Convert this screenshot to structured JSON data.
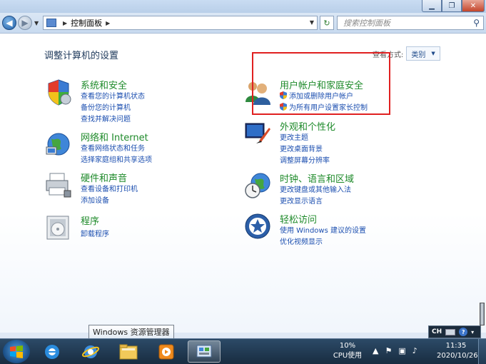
{
  "window": {
    "minimize_icon": "minimize-icon",
    "maximize_icon": "restore-icon",
    "close_icon": "close-icon"
  },
  "address_bar": {
    "breadcrumb": "控制面板",
    "search_placeholder": "搜索控制面板"
  },
  "main": {
    "title": "调整计算机的设置",
    "view_by_label": "查看方式:",
    "view_by_value": "类别"
  },
  "categories": {
    "system_security": {
      "title": "系统和安全",
      "links": [
        "查看您的计算机状态",
        "备份您的计算机",
        "查找并解决问题"
      ]
    },
    "network": {
      "title": "网络和 Internet",
      "links": [
        "查看网络状态和任务",
        "选择家庭组和共享选项"
      ]
    },
    "hardware": {
      "title": "硬件和声音",
      "links": [
        "查看设备和打印机",
        "添加设备"
      ]
    },
    "programs": {
      "title": "程序",
      "links": [
        "卸载程序"
      ]
    },
    "user_accounts": {
      "title": "用户帐户和家庭安全",
      "links": [
        "添加或删除用户帐户",
        "为所有用户设置家长控制"
      ]
    },
    "appearance": {
      "title": "外观和个性化",
      "links": [
        "更改主题",
        "更改桌面背景",
        "调整屏幕分辨率"
      ]
    },
    "clock_region": {
      "title": "时钟、语言和区域",
      "links": [
        "更改键盘或其他输入法",
        "更改显示语言"
      ]
    },
    "ease_access": {
      "title": "轻松访问",
      "links": [
        "使用 Windows 建议的设置",
        "优化视频显示"
      ]
    }
  },
  "taskbar": {
    "tooltip": "Windows 资源管理器",
    "cpu_percent": "10%",
    "cpu_label": "CPU使用",
    "time": "11:35",
    "date": "2020/10/26",
    "lang": "CH"
  },
  "colors": {
    "category_title": "#1e8a2a",
    "link": "#1c4fb0",
    "highlight_box": "#e02020"
  }
}
